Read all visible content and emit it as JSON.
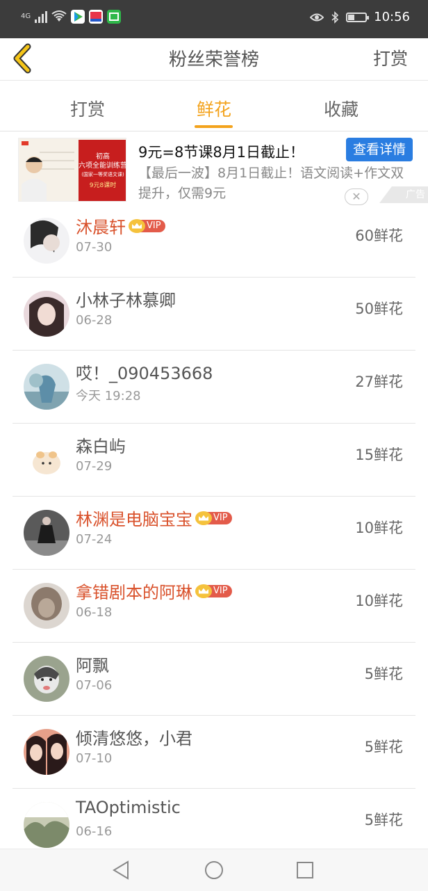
{
  "status_bar": {
    "network": "4G",
    "time": "10:56"
  },
  "header": {
    "title": "粉丝荣誉榜",
    "right_action": "打赏"
  },
  "tabs": [
    {
      "label": "打赏"
    },
    {
      "label": "鲜花"
    },
    {
      "label": "收藏"
    }
  ],
  "active_tab": "鲜花",
  "ad": {
    "title": "9元=8节课8月1日截止！",
    "button": "查看详情",
    "description": "【最后一波】8月1日截止！语文阅读+作文双提升，仅需9元",
    "tag": "广告",
    "image_text": {
      "top": "初高",
      "main": "六项全能训练营",
      "sub": "(国家一等奖语文课)",
      "price": "9元8课时"
    }
  },
  "fans": [
    {
      "name": "沐晨轩",
      "date": "07-30",
      "amount": "60鲜花",
      "vip": true,
      "vip_label": "VIP"
    },
    {
      "name": "小林子林慕卿",
      "date": "06-28",
      "amount": "50鲜花",
      "vip": false
    },
    {
      "name": "哎！_090453668",
      "date": "今天 19:28",
      "amount": "27鲜花",
      "vip": false
    },
    {
      "name": "森白屿",
      "date": "07-29",
      "amount": "15鲜花",
      "vip": false
    },
    {
      "name": "林渊是电脑宝宝",
      "date": "07-24",
      "amount": "10鲜花",
      "vip": true,
      "vip_label": "VIP"
    },
    {
      "name": "拿错剧本的阿琳",
      "date": "06-18",
      "amount": "10鲜花",
      "vip": true,
      "vip_label": "VIP"
    },
    {
      "name": "阿飘",
      "date": "07-06",
      "amount": "5鲜花",
      "vip": false
    },
    {
      "name": "倾清悠悠，小君",
      "date": "07-10",
      "amount": "5鲜花",
      "vip": false
    },
    {
      "name": "TAOptimistic",
      "date": "06-16",
      "amount": "5鲜花",
      "vip": false
    }
  ],
  "colors": {
    "accent": "#f3a31d",
    "vip_name": "#d9522c",
    "ad_button": "#2a7de1",
    "status_bar": "#3c3c3c"
  },
  "icons": {
    "back": "chevron-left-icon",
    "nav_back": "triangle-back-icon",
    "nav_home": "circle-home-icon",
    "nav_recent": "square-recent-icon"
  }
}
